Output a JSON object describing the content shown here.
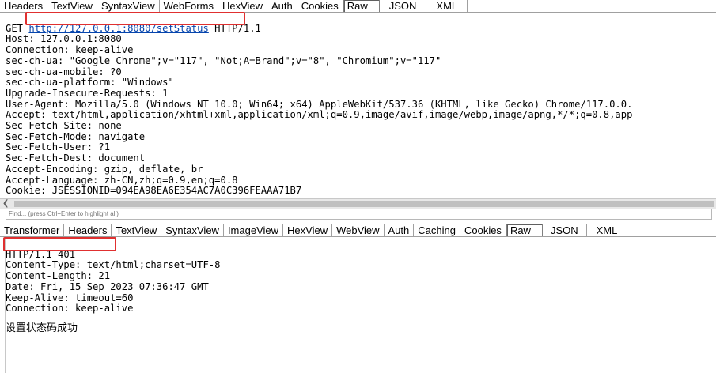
{
  "request": {
    "tabs": [
      "Headers",
      "TextView",
      "SyntaxView",
      "WebForms",
      "HexView",
      "Auth",
      "Cookies",
      "Raw",
      "JSON",
      "XML"
    ],
    "active_tab": "Raw",
    "method": "GET",
    "url": "http://127.0.0.1:8080/setStatus",
    "protocol": "HTTP/1.1",
    "headers": [
      "Host: 127.0.0.1:8080",
      "Connection: keep-alive",
      "sec-ch-ua: \"Google Chrome\";v=\"117\", \"Not;A=Brand\";v=\"8\", \"Chromium\";v=\"117\"",
      "sec-ch-ua-mobile: ?0",
      "sec-ch-ua-platform: \"Windows\"",
      "Upgrade-Insecure-Requests: 1",
      "User-Agent: Mozilla/5.0 (Windows NT 10.0; Win64; x64) AppleWebKit/537.36 (KHTML, like Gecko) Chrome/117.0.0.",
      "Accept: text/html,application/xhtml+xml,application/xml;q=0.9,image/avif,image/webp,image/apng,*/*;q=0.8,app",
      "Sec-Fetch-Site: none",
      "Sec-Fetch-Mode: navigate",
      "Sec-Fetch-User: ?1",
      "Sec-Fetch-Dest: document",
      "Accept-Encoding: gzip, deflate, br",
      "Accept-Language: zh-CN,zh;q=0.9,en;q=0.8",
      "Cookie: JSESSIONID=094EA98EA6E354AC7A0C396FEAAA71B7"
    ]
  },
  "find_bar": {
    "placeholder": "Find... (press Ctrl+Enter to highlight all)"
  },
  "response": {
    "tabs": [
      "Transformer",
      "Headers",
      "TextView",
      "SyntaxView",
      "ImageView",
      "HexView",
      "WebView",
      "Auth",
      "Caching",
      "Cookies",
      "Raw",
      "JSON",
      "XML"
    ],
    "active_tab": "Raw",
    "status_line": "HTTP/1.1 401",
    "headers": [
      "Content-Type: text/html;charset=UTF-8",
      "Content-Length: 21",
      "Date: Fri, 15 Sep 2023 07:36:47 GMT",
      "Keep-Alive: timeout=60",
      "Connection: keep-alive"
    ],
    "body": "设置状态码成功"
  },
  "colors": {
    "highlight_box": "#e03030",
    "link": "#0645ad"
  }
}
